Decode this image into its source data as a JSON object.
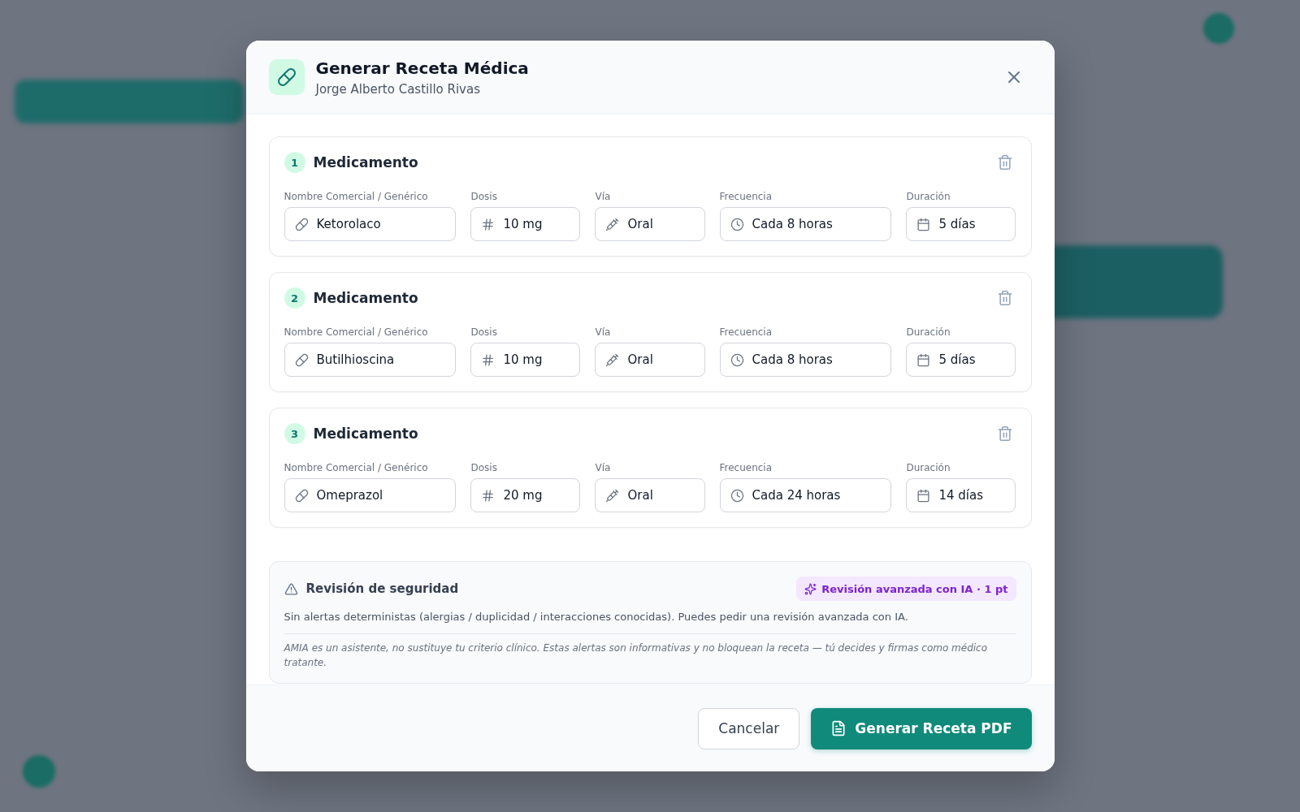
{
  "dialog": {
    "title": "Generar Receta Médica",
    "subtitle": "Jorge Alberto Castillo Rivas"
  },
  "medications": [
    {
      "number": "1",
      "heading": "Medicamento",
      "fields": [
        {
          "kind": "name",
          "label": "Nombre Comercial / Genérico",
          "value": "Ketorolaco"
        },
        {
          "kind": "dose",
          "label": "Dosis",
          "value": "10 mg"
        },
        {
          "kind": "route",
          "label": "Vía",
          "value": "Oral"
        },
        {
          "kind": "frequency",
          "label": "Frecuencia",
          "value": "Cada 8 horas"
        },
        {
          "kind": "duration",
          "label": "Duración",
          "value": "5 días"
        }
      ]
    },
    {
      "number": "2",
      "heading": "Medicamento",
      "fields": [
        {
          "kind": "name",
          "label": "Nombre Comercial / Genérico",
          "value": "Butilhioscina"
        },
        {
          "kind": "dose",
          "label": "Dosis",
          "value": "10 mg"
        },
        {
          "kind": "route",
          "label": "Vía",
          "value": "Oral"
        },
        {
          "kind": "frequency",
          "label": "Frecuencia",
          "value": "Cada 8 horas"
        },
        {
          "kind": "duration",
          "label": "Duración",
          "value": "5 días"
        }
      ]
    },
    {
      "number": "3",
      "heading": "Medicamento",
      "fields": [
        {
          "kind": "name",
          "label": "Nombre Comercial / Genérico",
          "value": "Omeprazol"
        },
        {
          "kind": "dose",
          "label": "Dosis",
          "value": "20 mg"
        },
        {
          "kind": "route",
          "label": "Vía",
          "value": "Oral"
        },
        {
          "kind": "frequency",
          "label": "Frecuencia",
          "value": "Cada 24 horas"
        },
        {
          "kind": "duration",
          "label": "Duración",
          "value": "14 días"
        }
      ]
    }
  ],
  "safety_review": {
    "title": "Revisión de seguridad",
    "ai_button": "Revisión avanzada con IA · 1 pt",
    "message": "Sin alertas deterministas (alergias / duplicidad / interacciones conocidas). Puedes pedir una revisión avanzada con IA.",
    "disclaimer": "AMIA es un asistente, no sustituye tu criterio clínico. Estas alertas son informativas y no bloquean la receta — tú decides y firmas como médico tratante."
  },
  "footer": {
    "buttons": [
      {
        "kind": "secondary",
        "label": "Cancelar"
      },
      {
        "kind": "primary",
        "label": "Generar Receta PDF"
      }
    ]
  }
}
